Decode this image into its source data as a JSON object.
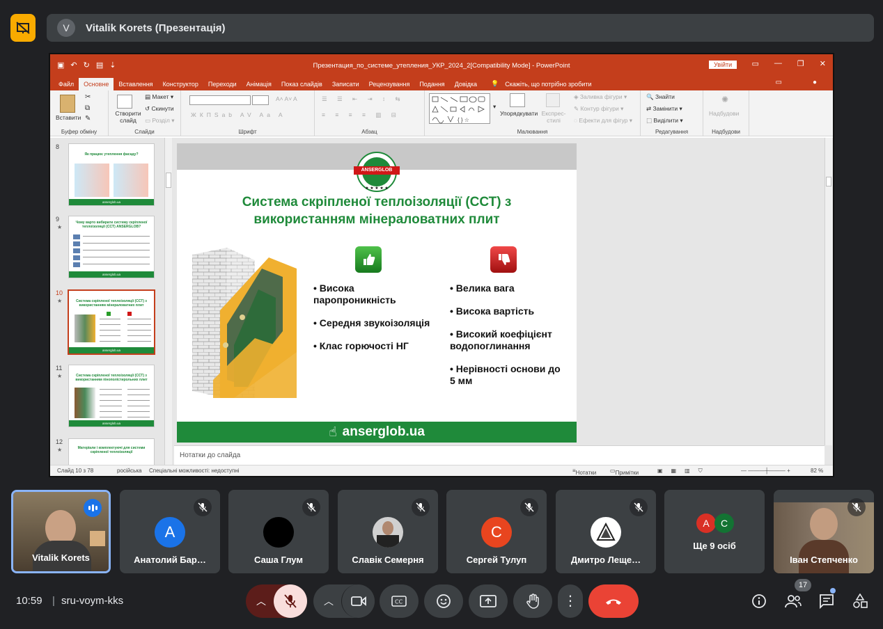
{
  "meet": {
    "presenter_initial": "V",
    "presenter_label": "Vitalik Korets (Презентація)",
    "time": "10:59",
    "separator": "|",
    "meeting_code": "sru-voym-kks",
    "participants_count": "17",
    "more_people_label": "Ще 9 осіб",
    "accent": "#8ab4f8",
    "end_call_color": "#ea4335"
  },
  "powerpoint": {
    "window_title": "Презентация_по_системе_утепления_УКР_2024_2[Compatibility Mode]  -  PowerPoint",
    "login_label": "Увійти",
    "tabs": [
      "Файл",
      "Основне",
      "Вставлення",
      "Конструктор",
      "Переходи",
      "Анімація",
      "Показ слайдів",
      "Записати",
      "Рецензування",
      "Подання",
      "Довідка"
    ],
    "tell_me": "Скажіть, що потрібно зробити",
    "ribbon": {
      "paste": "Вставити",
      "clipboard": "Буфер обміну",
      "new_slide": "Створити слайд",
      "layout": "Макет",
      "reset": "Скинути",
      "section": "Розділ",
      "slides": "Слайди",
      "font": "Шрифт",
      "paragraph": "Абзац",
      "arrange": "Упорядкувати",
      "quick_styles": "Експрес-стилі",
      "shape_fill": "Заливка фігури",
      "shape_outline": "Контур фігури",
      "shape_effects": "Ефекти для фігур",
      "drawing": "Малювання",
      "find": "Знайти",
      "replace": "Замінити",
      "select": "Виділити",
      "editing": "Редагування",
      "addins_btn": "Надбудови",
      "addins": "Надбудови"
    },
    "thumbnails": [
      {
        "num": "8",
        "star": "",
        "title": "Як працює утеплення фасаду?"
      },
      {
        "num": "9",
        "star": "★",
        "title": "Чому варто вибирати систему скріпленої теплоізоляції (ССТ) ANSERGLOB?"
      },
      {
        "num": "10",
        "star": "★",
        "title": "Система скріпленої теплоізоляції (ССТ) з використанням мінераловатних плит"
      },
      {
        "num": "11",
        "star": "★",
        "title": "Система скріпленої теплоізоляції (ССТ) з використанням пінополістирольних плит"
      },
      {
        "num": "12",
        "star": "★",
        "title": "Матеріали і комплектуючі для системи скріпленої теплоізоляції"
      }
    ],
    "thumb_footer": "anserglob.ua",
    "notes_placeholder": "Нотатки до слайда",
    "status": {
      "slide_of": "Слайд 10 з 78",
      "language": "російська",
      "accessibility": "Спеціальні можливості: недоступні",
      "notes": "Нотатки",
      "comments": "Примітки",
      "zoom": "82 %"
    }
  },
  "slide": {
    "logo_text": "ANSERGLOB",
    "stars": "★ ★ ★ ★ ★",
    "title": "Система скріпленої теплоізоляції (ССТ) з використанням мінераловатних плит",
    "pros": [
      "Висока паропроникність",
      "Середня звукоізоляція",
      "Клас горючості НГ"
    ],
    "cons": [
      "Велика вага",
      "Висока вартість",
      "Високий коефіцієнт водопоглинання",
      "Нерівності основи до 5 мм"
    ],
    "footer": "anserglob.ua",
    "brand_green": "#1f8a3a",
    "brand_red": "#d01818"
  },
  "participants": [
    {
      "name": "Vitalik Korets",
      "initial": "",
      "color": "#6d5a44"
    },
    {
      "name": "Анатолий Бар…",
      "initial": "А",
      "color": "#1a73e8"
    },
    {
      "name": "Саша Глум",
      "initial": "",
      "color": "#000000"
    },
    {
      "name": "Славік Семерня",
      "initial": "",
      "color": "#5f6368"
    },
    {
      "name": "Сергей Тулуп",
      "initial": "С",
      "color": "#e8451f"
    },
    {
      "name": "Дмитро Леще…",
      "initial": "",
      "color": "#ffffff"
    },
    {
      "name": "",
      "initial": "",
      "color": "#3c4043"
    },
    {
      "name": "Іван Степченко",
      "initial": "",
      "color": "#7a6a5a"
    }
  ],
  "more_avatars": [
    {
      "initial": "А",
      "color": "#d93025"
    },
    {
      "initial": "С",
      "color": "#137333"
    }
  ]
}
